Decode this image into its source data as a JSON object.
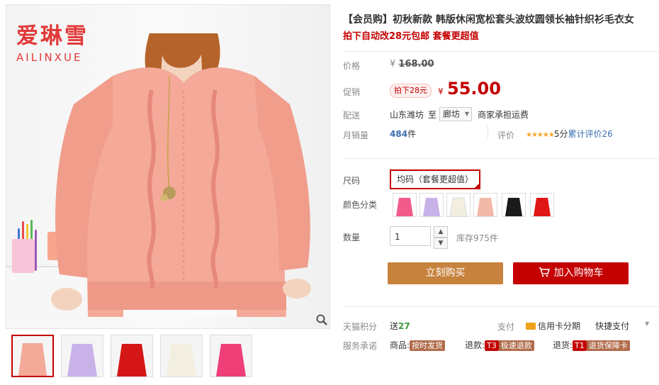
{
  "brand": {
    "cn": "爱琳雪",
    "en": "AILINXUE"
  },
  "product": {
    "title": "【会员购】初秋新款 韩版休闲宽松套头波纹圆领长袖针织衫毛衣女",
    "subtitle": "拍下自动改28元包邮 套餐更超值"
  },
  "price": {
    "label": "价格",
    "currency": "¥",
    "value": "168.00"
  },
  "promo": {
    "label": "促销",
    "badge": "拍下28元",
    "currency": "¥",
    "value": "55.00"
  },
  "shipping": {
    "label": "配送",
    "from": "山东潍坊",
    "to_word": "至",
    "dest": "廊坊",
    "note": "商家承担运费"
  },
  "sales": {
    "label": "月销量",
    "count": "484",
    "unit": "件",
    "rating_label": "评价",
    "stars": "★★★★★",
    "score": "5分",
    "reviews": "累计评价26"
  },
  "size": {
    "label": "尺码",
    "selected": "均码（套餐更超值）"
  },
  "color": {
    "label": "颜色分类",
    "swatches": [
      "#f25a8a",
      "#c9b2e8",
      "#f2efe0",
      "#f3b9a8",
      "#1a1a1a",
      "#e01616"
    ]
  },
  "quantity": {
    "label": "数量",
    "value": "1",
    "stock": "库存975件"
  },
  "buttons": {
    "buy": "立刻购买",
    "cart": "加入购物车"
  },
  "points": {
    "label": "天猫积分",
    "give": "送",
    "value": "27",
    "pay_label": "支付",
    "card": "信用卡分期",
    "quick": "快捷支付"
  },
  "service": {
    "label": "服务承诺",
    "item1": {
      "prefix": "商品:",
      "tag": "按时发货"
    },
    "item2": {
      "prefix": "退款:",
      "tag_num": "T3",
      "tag": "极速退款"
    },
    "item3": {
      "prefix": "退货:",
      "tag_num": "T1",
      "tag": "退货保障卡"
    }
  },
  "thumbnails": [
    "#f4aa98",
    "#c9b2e8",
    "#d51616",
    "#f2efe0",
    "#ef3f78"
  ],
  "colors": {
    "accent": "#c40000",
    "buy": "#c7823e",
    "sweater": "#f4a999"
  }
}
